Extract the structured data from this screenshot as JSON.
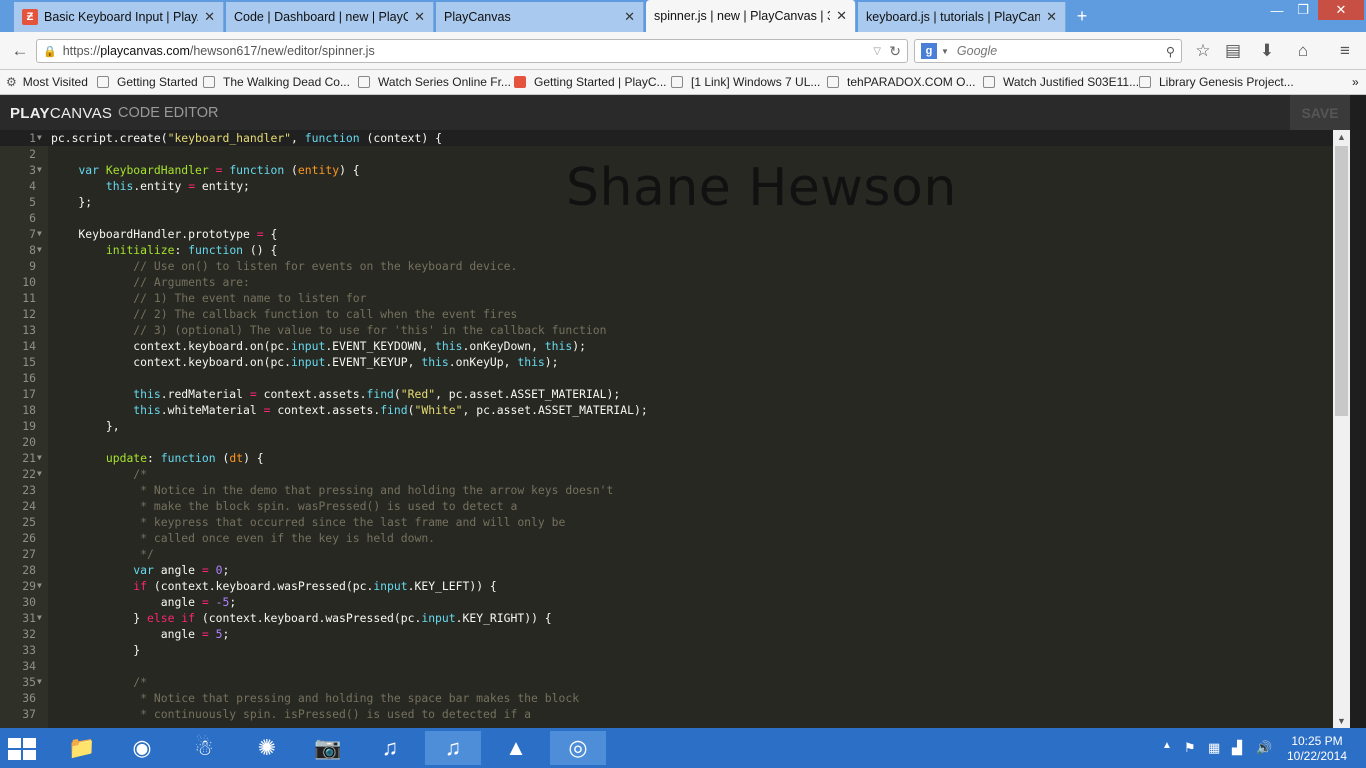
{
  "tabs": [
    {
      "title": "Basic Keyboard Input | Play...",
      "active": false,
      "favicon": true
    },
    {
      "title": "Code | Dashboard | new | PlayC...",
      "active": false,
      "favicon": false
    },
    {
      "title": "PlayCanvas",
      "active": false,
      "favicon": false
    },
    {
      "title": "spinner.js | new | PlayCanvas | 3...",
      "active": true,
      "favicon": false
    },
    {
      "title": "keyboard.js | tutorials | PlayCan...",
      "active": false,
      "favicon": false
    }
  ],
  "tab_close": "✕",
  "new_tab": "+",
  "window_controls": {
    "minimize": "—",
    "maximize": "❐",
    "close": "✕"
  },
  "nav": {
    "url_prefix": "https://",
    "url_host": "playcanvas.com",
    "url_path": "/hewson617/new/editor/spinner.js",
    "search_placeholder": "Google",
    "search_engine_letter": "g"
  },
  "bookmarks": [
    {
      "label": "Most Visited",
      "icon": "gear"
    },
    {
      "label": "Getting Started",
      "icon": "page"
    },
    {
      "label": "The Walking Dead Co...",
      "icon": "page"
    },
    {
      "label": "Watch Series Online Fr...",
      "icon": "page"
    },
    {
      "label": "Getting Started | PlayC...",
      "icon": "playcanvas"
    },
    {
      "label": "[1 Link] Windows 7 UL...",
      "icon": "page"
    },
    {
      "label": "tehPARADOX.COM O...",
      "icon": "page"
    },
    {
      "label": "Watch Justified S03E11...",
      "icon": "page"
    },
    {
      "label": "Library Genesis Project...",
      "icon": "page"
    }
  ],
  "bookmarks_overflow": "»",
  "app": {
    "logo_bold": "PLAY",
    "logo_rest": "CANVAS",
    "section": "CODE EDITOR",
    "save_label": "SAVE"
  },
  "watermark": "Shane Hewson",
  "code_lines": [
    {
      "n": "1",
      "fold": true,
      "html": "<span class='p'></span>pc.script.create(<span class='s'>\"keyboard_handler\"</span>, <span class='k'>function</span> (context) {"
    },
    {
      "n": "2",
      "fold": false,
      "html": ""
    },
    {
      "n": "3",
      "fold": true,
      "html": "    <span class='k'>var</span> <span class='f'>KeyboardHandler</span> <span class='o'>=</span> <span class='k'>function</span> (<span class='p'>entity</span>) {"
    },
    {
      "n": "4",
      "fold": false,
      "html": "        <span class='k'>this</span>.entity <span class='o'>=</span> entity;"
    },
    {
      "n": "5",
      "fold": false,
      "html": "    };"
    },
    {
      "n": "6",
      "fold": false,
      "html": ""
    },
    {
      "n": "7",
      "fold": true,
      "html": "    KeyboardHandler.prototype <span class='o'>=</span> {"
    },
    {
      "n": "8",
      "fold": true,
      "html": "        <span class='f'>initialize</span>: <span class='k'>function</span> () {"
    },
    {
      "n": "9",
      "fold": false,
      "html": "            <span class='c'>// Use on() to listen for events on the keyboard device.</span>"
    },
    {
      "n": "10",
      "fold": false,
      "html": "            <span class='c'>// Arguments are:</span>"
    },
    {
      "n": "11",
      "fold": false,
      "html": "            <span class='c'>// 1) The event name to listen for</span>"
    },
    {
      "n": "12",
      "fold": false,
      "html": "            <span class='c'>// 2) The callback function to call when the event fires</span>"
    },
    {
      "n": "13",
      "fold": false,
      "html": "            <span class='c'>// 3) (optional) The value to use for 'this' in the callback function</span>"
    },
    {
      "n": "14",
      "fold": false,
      "html": "            context.keyboard.on(pc.<span class='k'>input</span>.EVENT_KEYDOWN, <span class='k'>this</span>.onKeyDown, <span class='k'>this</span>);"
    },
    {
      "n": "15",
      "fold": false,
      "html": "            context.keyboard.on(pc.<span class='k'>input</span>.EVENT_KEYUP, <span class='k'>this</span>.onKeyUp, <span class='k'>this</span>);"
    },
    {
      "n": "16",
      "fold": false,
      "html": ""
    },
    {
      "n": "17",
      "fold": false,
      "html": "            <span class='k'>this</span>.redMaterial <span class='o'>=</span> context.assets.<span class='k'>find</span>(<span class='s'>\"Red\"</span>, pc.asset.ASSET_MATERIAL);"
    },
    {
      "n": "18",
      "fold": false,
      "html": "            <span class='k'>this</span>.whiteMaterial <span class='o'>=</span> context.assets.<span class='k'>find</span>(<span class='s'>\"White\"</span>, pc.asset.ASSET_MATERIAL);"
    },
    {
      "n": "19",
      "fold": false,
      "html": "        },"
    },
    {
      "n": "20",
      "fold": false,
      "html": ""
    },
    {
      "n": "21",
      "fold": true,
      "html": "        <span class='f'>update</span>: <span class='k'>function</span> (<span class='p'>dt</span>) {"
    },
    {
      "n": "22",
      "fold": true,
      "html": "            <span class='c'>/*</span>"
    },
    {
      "n": "23",
      "fold": false,
      "html": "<span class='c'>             * Notice in the demo that pressing and holding the arrow keys doesn't</span>"
    },
    {
      "n": "24",
      "fold": false,
      "html": "<span class='c'>             * make the block spin. wasPressed() is used to detect a</span>"
    },
    {
      "n": "25",
      "fold": false,
      "html": "<span class='c'>             * keypress that occurred since the last frame and will only be</span>"
    },
    {
      "n": "26",
      "fold": false,
      "html": "<span class='c'>             * called once even if the key is held down.</span>"
    },
    {
      "n": "27",
      "fold": false,
      "html": "<span class='c'>             */</span>"
    },
    {
      "n": "28",
      "fold": false,
      "html": "            <span class='k'>var</span> angle <span class='o'>=</span> <span class='n'>0</span>;"
    },
    {
      "n": "29",
      "fold": true,
      "html": "            <span class='o'>if</span> (context.keyboard.wasPressed(pc.<span class='k'>input</span>.KEY_LEFT)) {"
    },
    {
      "n": "30",
      "fold": false,
      "html": "                angle <span class='o'>=</span> <span class='n'>-5</span>;"
    },
    {
      "n": "31",
      "fold": true,
      "html": "            } <span class='o'>else if</span> (context.keyboard.wasPressed(pc.<span class='k'>input</span>.KEY_RIGHT)) {"
    },
    {
      "n": "32",
      "fold": false,
      "html": "                angle <span class='o'>=</span> <span class='n'>5</span>;"
    },
    {
      "n": "33",
      "fold": false,
      "html": "            }"
    },
    {
      "n": "34",
      "fold": false,
      "html": ""
    },
    {
      "n": "35",
      "fold": true,
      "html": "            <span class='c'>/*</span>"
    },
    {
      "n": "36",
      "fold": false,
      "html": "<span class='c'>             * Notice that pressing and holding the space bar makes the block</span>"
    },
    {
      "n": "37",
      "fold": false,
      "html": "<span class='c'>             * continuously spin. isPressed() is used to detected if a</span>"
    }
  ],
  "taskbar": {
    "items": [
      {
        "name": "file-explorer-icon",
        "glyph": "📁",
        "active": false
      },
      {
        "name": "chrome-icon",
        "glyph": "◉",
        "active": false
      },
      {
        "name": "app-character-icon",
        "glyph": "☃",
        "active": false
      },
      {
        "name": "app-satellite-icon",
        "glyph": "✺",
        "active": false
      },
      {
        "name": "camera-app-icon",
        "glyph": "📷",
        "active": false
      },
      {
        "name": "itunes-icon",
        "glyph": "♫",
        "active": false
      },
      {
        "name": "itunes-icon-2",
        "glyph": "♫",
        "active": true
      },
      {
        "name": "vlc-icon",
        "glyph": "▲",
        "active": false
      },
      {
        "name": "firefox-icon",
        "glyph": "◎",
        "active": true
      }
    ],
    "time": "10:25 PM",
    "date": "10/22/2014"
  },
  "colors": {
    "editor_bg": "#272822",
    "taskbar": "#2b6fc6",
    "tabbar": "#5e9cdf",
    "brand": "#e4543d"
  }
}
